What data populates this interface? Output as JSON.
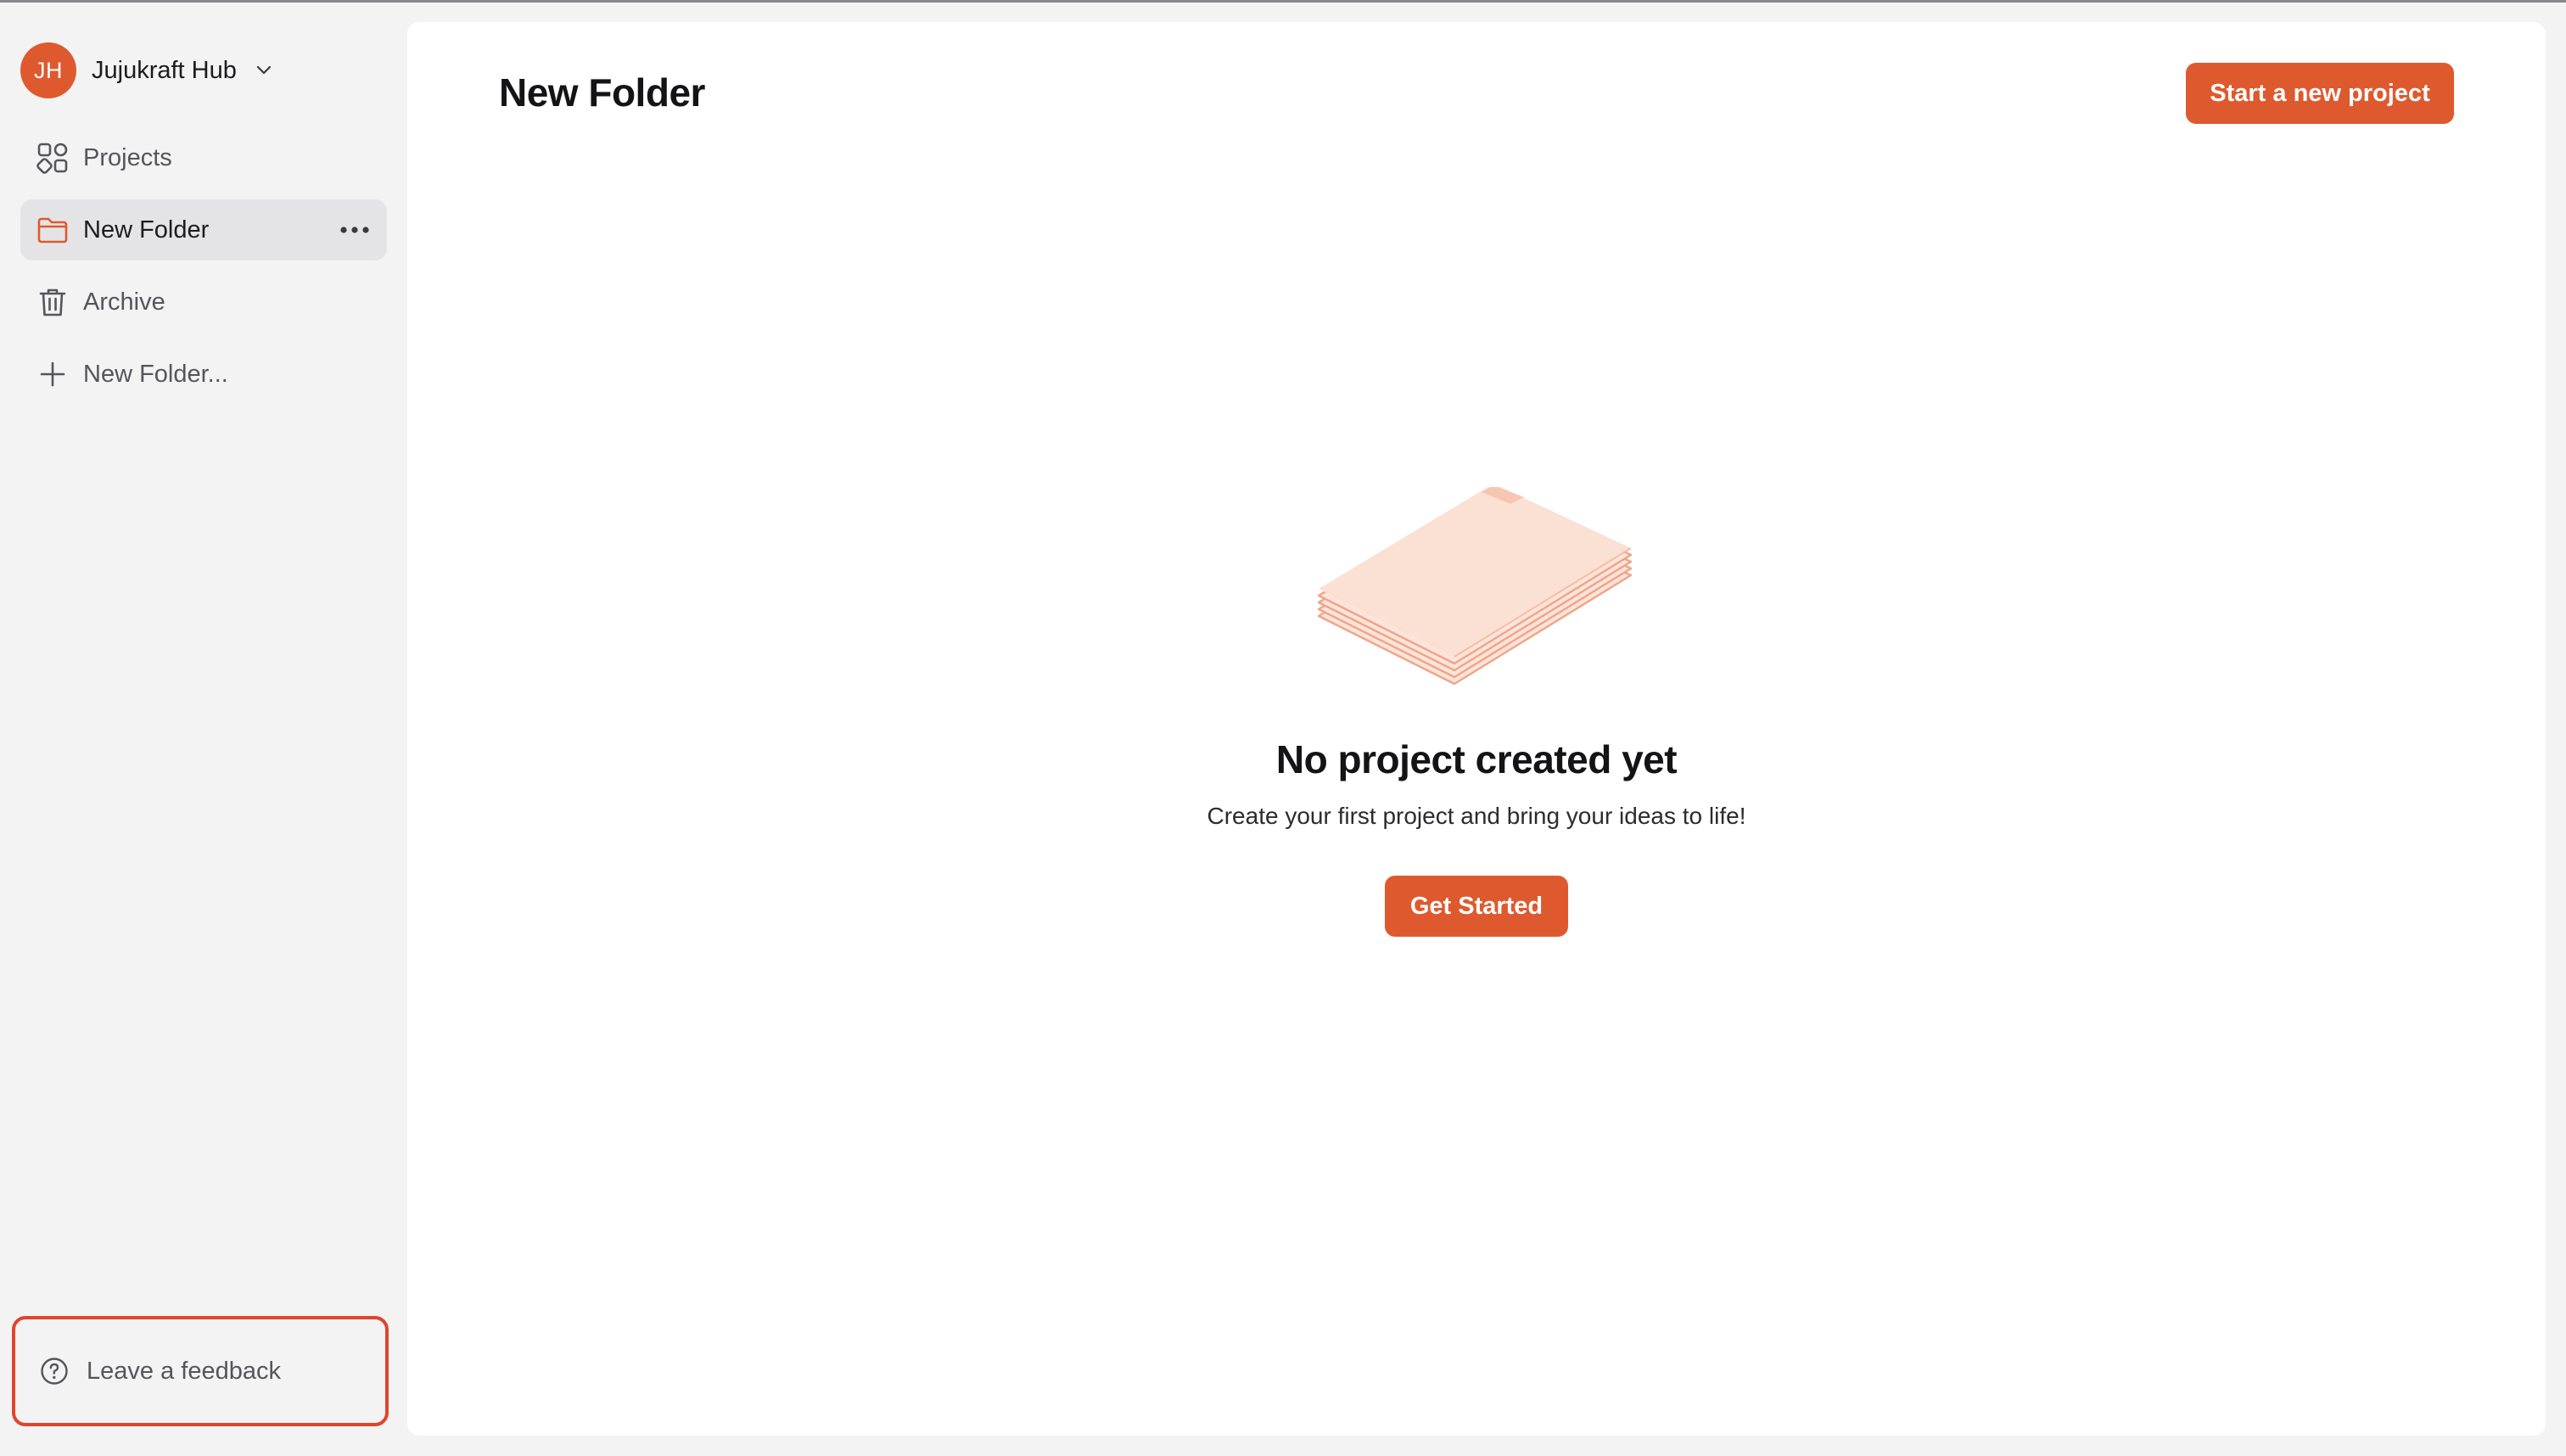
{
  "workspace": {
    "initials": "JH",
    "name": "Jujukraft Hub",
    "icon": "chevron-down-icon"
  },
  "sidebar": {
    "items": [
      {
        "label": "Projects",
        "icon": "grid-icon",
        "active": false
      },
      {
        "label": "New Folder",
        "icon": "folder-icon",
        "active": true
      },
      {
        "label": "Archive",
        "icon": "trash-icon",
        "active": false
      },
      {
        "label": "New Folder...",
        "icon": "plus-icon",
        "active": false
      }
    ],
    "feedback": {
      "label": "Leave a feedback",
      "icon": "help-circle-icon"
    }
  },
  "main": {
    "title": "New Folder",
    "start_button": "Start a new project",
    "empty": {
      "title": "No project created yet",
      "subtitle": "Create your first project and bring your ideas to life!",
      "button": "Get Started",
      "illustration": "paper-stack"
    }
  },
  "colors": {
    "accent": "#de5a2e",
    "highlight_border": "#e0452c",
    "sidebar_bg": "#f3f3f4",
    "active_item_bg": "#e4e4e6",
    "paper_fill": "#fde4da",
    "paper_stroke": "#f0a488"
  }
}
